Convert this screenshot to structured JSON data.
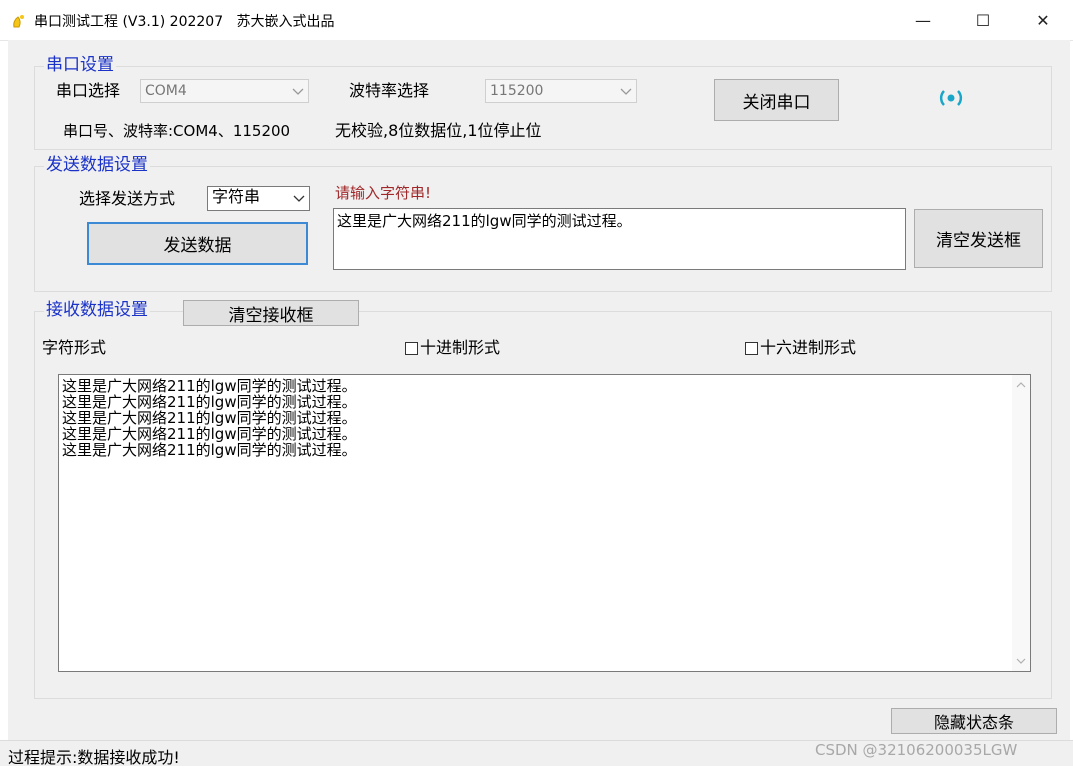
{
  "window": {
    "title": "串口测试工程 (V3.1) 202207   苏大嵌入式出品",
    "minimize": "—",
    "maximize": "☐",
    "close": "✕"
  },
  "serial": {
    "group_title": "串口设置",
    "port_label": "串口选择",
    "port_value": "COM4",
    "baud_label": "波特率选择",
    "baud_value": "115200",
    "close_button": "关闭串口",
    "status_icon": "wireless-signal-icon",
    "info_text": "串口号、波特率:COM4、115200",
    "info_text2": "无校验,8位数据位,1位停止位"
  },
  "send": {
    "group_title": "发送数据设置",
    "mode_label": "选择发送方式",
    "mode_value": "字符串",
    "send_button": "发送数据",
    "prompt": "请输入字符串!",
    "input_value": "这里是广大网络211的lgw同学的测试过程。",
    "clear_button": "清空发送框"
  },
  "receive": {
    "group_title": "接收数据设置",
    "clear_button": "清空接收框",
    "char_label": "字符形式",
    "dec_label": "十进制形式",
    "hex_label": "十六进制形式",
    "lines": [
      "这里是广大网络211的lgw同学的测试过程。",
      "这里是广大网络211的lgw同学的测试过程。",
      "这里是广大网络211的lgw同学的测试过程。",
      "这里是广大网络211的lgw同学的测试过程。",
      "这里是广大网络211的lgw同学的测试过程。"
    ]
  },
  "hide_status_button": "隐藏状态条",
  "status": {
    "text": "过程提示:数据接收成功!",
    "watermark": "CSDN @32106200035LGW"
  },
  "colors": {
    "group_title": "#1a32c8",
    "prompt": "#a0282a",
    "signal": "#1aa6c8"
  }
}
